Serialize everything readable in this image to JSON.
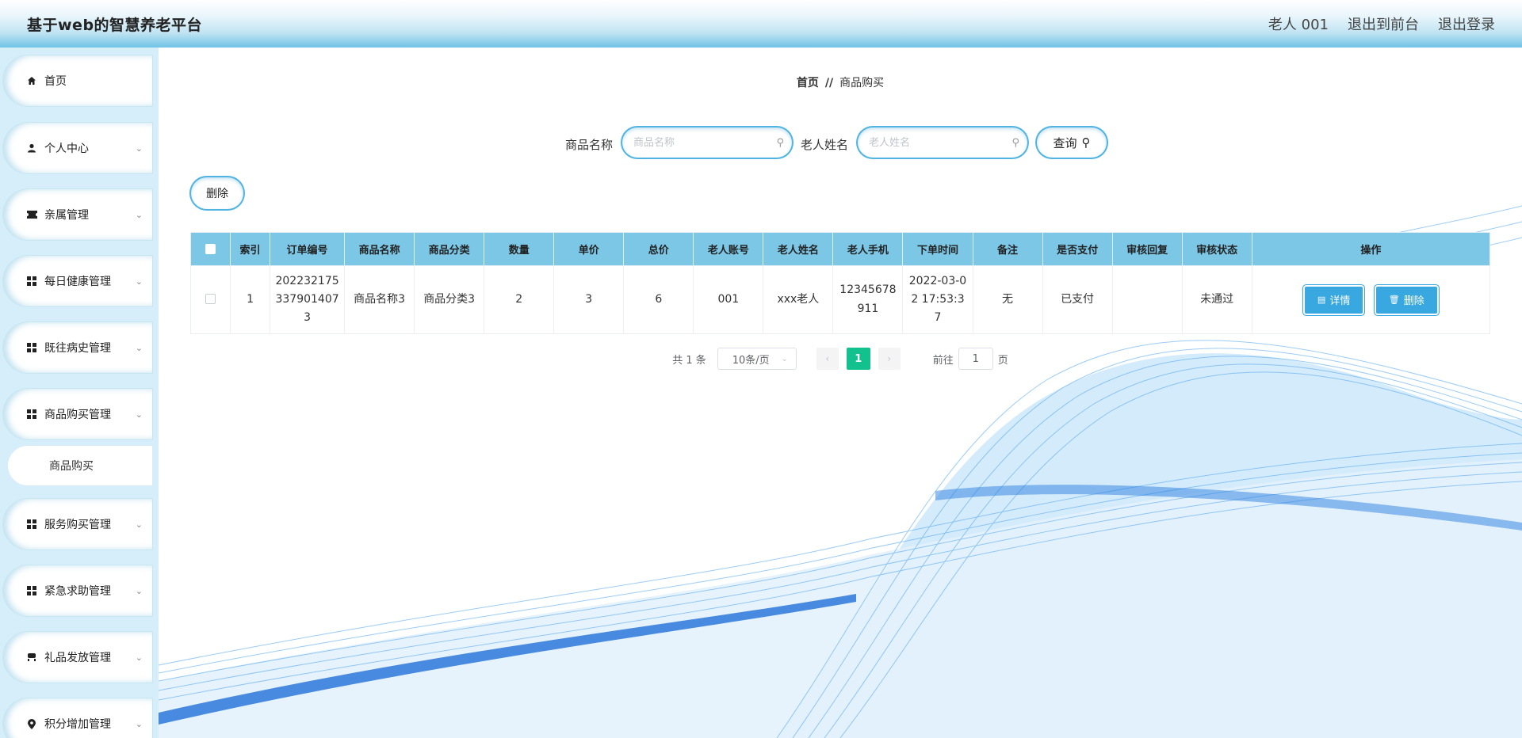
{
  "app": {
    "title": "基于web的智慧养老平台"
  },
  "header": {
    "user_label": "老人 001",
    "back_front_label": "退出到前台",
    "logout_label": "退出登录"
  },
  "sidebar": {
    "items": [
      {
        "label": "首页",
        "icon": "home-icon"
      },
      {
        "label": "个人中心",
        "icon": "user-icon"
      },
      {
        "label": "亲属管理",
        "icon": "ticket-icon"
      },
      {
        "label": "每日健康管理",
        "icon": "grid-icon"
      },
      {
        "label": "既往病史管理",
        "icon": "grid-icon"
      },
      {
        "label": "商品购买管理",
        "icon": "grid-icon"
      },
      {
        "label": "服务购买管理",
        "icon": "grid-icon"
      },
      {
        "label": "紧急求助管理",
        "icon": "grid-icon"
      },
      {
        "label": "礼品发放管理",
        "icon": "chair-icon"
      },
      {
        "label": "积分增加管理",
        "icon": "pin-icon"
      }
    ],
    "subitem": {
      "label": "商品购买"
    }
  },
  "breadcrumb": {
    "home": "首页",
    "separator": "//",
    "current": "商品购买"
  },
  "search": {
    "product_name_label": "商品名称",
    "product_name_placeholder": "商品名称",
    "elder_name_label": "老人姓名",
    "elder_name_placeholder": "老人姓名",
    "query_label": "查询"
  },
  "toolbar": {
    "delete_label": "删除"
  },
  "table": {
    "headers": [
      "索引",
      "订单编号",
      "商品名称",
      "商品分类",
      "数量",
      "单价",
      "总价",
      "老人账号",
      "老人姓名",
      "老人手机",
      "下单时间",
      "备注",
      "是否支付",
      "审核回复",
      "审核状态",
      "操作"
    ],
    "rows": [
      {
        "index": "1",
        "order_no": "2022321753379014073",
        "product_name": "商品名称3",
        "category": "商品分类3",
        "quantity": "2",
        "unit_price": "3",
        "total": "6",
        "elder_account": "001",
        "elder_name": "xxx老人",
        "elder_phone": "12345678911",
        "order_time": "2022-03-02 17:53:37",
        "remark": "无",
        "paid": "已支付",
        "review_reply": "",
        "review_status": "未通过",
        "detail_label": "详情",
        "delete_label": "删除"
      }
    ]
  },
  "pagination": {
    "total_text": "共 1 条",
    "page_size_text": "10条/页",
    "current_page": "1",
    "goto_prefix": "前往",
    "goto_value": "1",
    "goto_suffix": "页"
  },
  "colors": {
    "header_accent": "#6fc3e6",
    "table_header": "#7cc7e6",
    "button_blue": "#3aa8e0",
    "active_page": "#13c18f",
    "sidebar_bg": "#d6eef9"
  }
}
